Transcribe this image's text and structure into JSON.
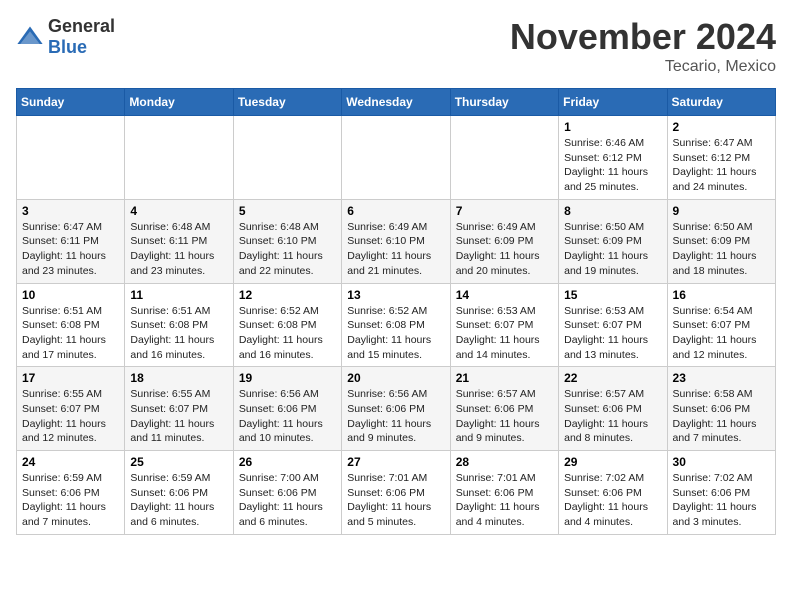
{
  "logo": {
    "general": "General",
    "blue": "Blue"
  },
  "header": {
    "month": "November 2024",
    "location": "Tecario, Mexico"
  },
  "weekdays": [
    "Sunday",
    "Monday",
    "Tuesday",
    "Wednesday",
    "Thursday",
    "Friday",
    "Saturday"
  ],
  "weeks": [
    [
      {
        "day": "",
        "info": ""
      },
      {
        "day": "",
        "info": ""
      },
      {
        "day": "",
        "info": ""
      },
      {
        "day": "",
        "info": ""
      },
      {
        "day": "",
        "info": ""
      },
      {
        "day": "1",
        "info": "Sunrise: 6:46 AM\nSunset: 6:12 PM\nDaylight: 11 hours and 25 minutes."
      },
      {
        "day": "2",
        "info": "Sunrise: 6:47 AM\nSunset: 6:12 PM\nDaylight: 11 hours and 24 minutes."
      }
    ],
    [
      {
        "day": "3",
        "info": "Sunrise: 6:47 AM\nSunset: 6:11 PM\nDaylight: 11 hours and 23 minutes."
      },
      {
        "day": "4",
        "info": "Sunrise: 6:48 AM\nSunset: 6:11 PM\nDaylight: 11 hours and 23 minutes."
      },
      {
        "day": "5",
        "info": "Sunrise: 6:48 AM\nSunset: 6:10 PM\nDaylight: 11 hours and 22 minutes."
      },
      {
        "day": "6",
        "info": "Sunrise: 6:49 AM\nSunset: 6:10 PM\nDaylight: 11 hours and 21 minutes."
      },
      {
        "day": "7",
        "info": "Sunrise: 6:49 AM\nSunset: 6:09 PM\nDaylight: 11 hours and 20 minutes."
      },
      {
        "day": "8",
        "info": "Sunrise: 6:50 AM\nSunset: 6:09 PM\nDaylight: 11 hours and 19 minutes."
      },
      {
        "day": "9",
        "info": "Sunrise: 6:50 AM\nSunset: 6:09 PM\nDaylight: 11 hours and 18 minutes."
      }
    ],
    [
      {
        "day": "10",
        "info": "Sunrise: 6:51 AM\nSunset: 6:08 PM\nDaylight: 11 hours and 17 minutes."
      },
      {
        "day": "11",
        "info": "Sunrise: 6:51 AM\nSunset: 6:08 PM\nDaylight: 11 hours and 16 minutes."
      },
      {
        "day": "12",
        "info": "Sunrise: 6:52 AM\nSunset: 6:08 PM\nDaylight: 11 hours and 16 minutes."
      },
      {
        "day": "13",
        "info": "Sunrise: 6:52 AM\nSunset: 6:08 PM\nDaylight: 11 hours and 15 minutes."
      },
      {
        "day": "14",
        "info": "Sunrise: 6:53 AM\nSunset: 6:07 PM\nDaylight: 11 hours and 14 minutes."
      },
      {
        "day": "15",
        "info": "Sunrise: 6:53 AM\nSunset: 6:07 PM\nDaylight: 11 hours and 13 minutes."
      },
      {
        "day": "16",
        "info": "Sunrise: 6:54 AM\nSunset: 6:07 PM\nDaylight: 11 hours and 12 minutes."
      }
    ],
    [
      {
        "day": "17",
        "info": "Sunrise: 6:55 AM\nSunset: 6:07 PM\nDaylight: 11 hours and 12 minutes."
      },
      {
        "day": "18",
        "info": "Sunrise: 6:55 AM\nSunset: 6:07 PM\nDaylight: 11 hours and 11 minutes."
      },
      {
        "day": "19",
        "info": "Sunrise: 6:56 AM\nSunset: 6:06 PM\nDaylight: 11 hours and 10 minutes."
      },
      {
        "day": "20",
        "info": "Sunrise: 6:56 AM\nSunset: 6:06 PM\nDaylight: 11 hours and 9 minutes."
      },
      {
        "day": "21",
        "info": "Sunrise: 6:57 AM\nSunset: 6:06 PM\nDaylight: 11 hours and 9 minutes."
      },
      {
        "day": "22",
        "info": "Sunrise: 6:57 AM\nSunset: 6:06 PM\nDaylight: 11 hours and 8 minutes."
      },
      {
        "day": "23",
        "info": "Sunrise: 6:58 AM\nSunset: 6:06 PM\nDaylight: 11 hours and 7 minutes."
      }
    ],
    [
      {
        "day": "24",
        "info": "Sunrise: 6:59 AM\nSunset: 6:06 PM\nDaylight: 11 hours and 7 minutes."
      },
      {
        "day": "25",
        "info": "Sunrise: 6:59 AM\nSunset: 6:06 PM\nDaylight: 11 hours and 6 minutes."
      },
      {
        "day": "26",
        "info": "Sunrise: 7:00 AM\nSunset: 6:06 PM\nDaylight: 11 hours and 6 minutes."
      },
      {
        "day": "27",
        "info": "Sunrise: 7:01 AM\nSunset: 6:06 PM\nDaylight: 11 hours and 5 minutes."
      },
      {
        "day": "28",
        "info": "Sunrise: 7:01 AM\nSunset: 6:06 PM\nDaylight: 11 hours and 4 minutes."
      },
      {
        "day": "29",
        "info": "Sunrise: 7:02 AM\nSunset: 6:06 PM\nDaylight: 11 hours and 4 minutes."
      },
      {
        "day": "30",
        "info": "Sunrise: 7:02 AM\nSunset: 6:06 PM\nDaylight: 11 hours and 3 minutes."
      }
    ]
  ]
}
